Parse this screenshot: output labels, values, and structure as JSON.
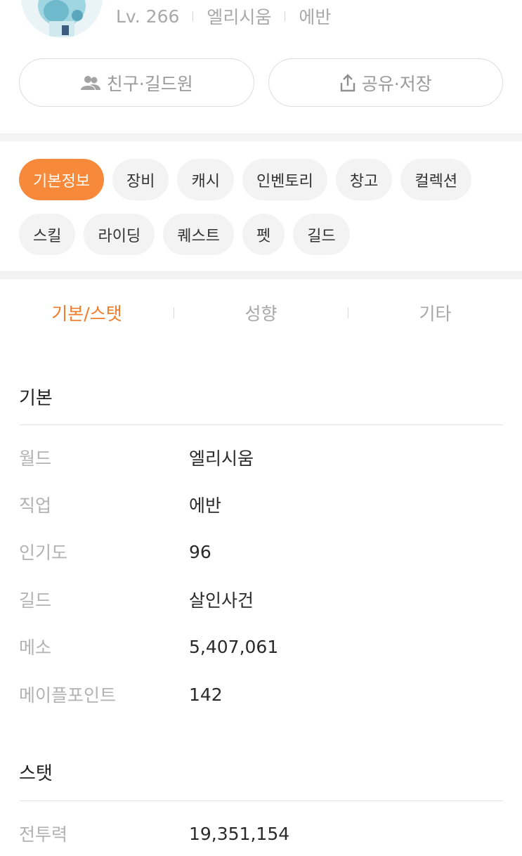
{
  "profile": {
    "level": "Lv. 266",
    "world": "엘리시움",
    "job": "에반"
  },
  "actions": {
    "friends_label": "친구·길드원",
    "share_label": "공유·저장"
  },
  "categories": {
    "row1": [
      "기본정보",
      "장비",
      "캐시",
      "인벤토리",
      "창고",
      "컬렉션"
    ],
    "row2": [
      "스킬",
      "라이딩",
      "퀘스트",
      "펫",
      "길드"
    ],
    "active": "기본정보"
  },
  "subtabs": [
    "기본/스탯",
    "성향",
    "기타"
  ],
  "basic": {
    "title": "기본",
    "rows": [
      {
        "label": "월드",
        "value": "엘리시움"
      },
      {
        "label": "직업",
        "value": "에반"
      },
      {
        "label": "인기도",
        "value": "96"
      },
      {
        "label": "길드",
        "value": "살인사건"
      },
      {
        "label": "메소",
        "value": "5,407,061"
      },
      {
        "label": "메이플포인트",
        "value": "142"
      }
    ]
  },
  "stats": {
    "title": "스탯",
    "rows": [
      {
        "label": "전투력",
        "value": "19,351,154"
      }
    ]
  },
  "colors": {
    "accent": "#f7893a",
    "accent_text": "#f07d2c",
    "chip_bg": "#f3f3f3",
    "muted": "#a9a9a9"
  },
  "icons": {
    "friends": "people-icon",
    "share": "share-upload-icon"
  }
}
